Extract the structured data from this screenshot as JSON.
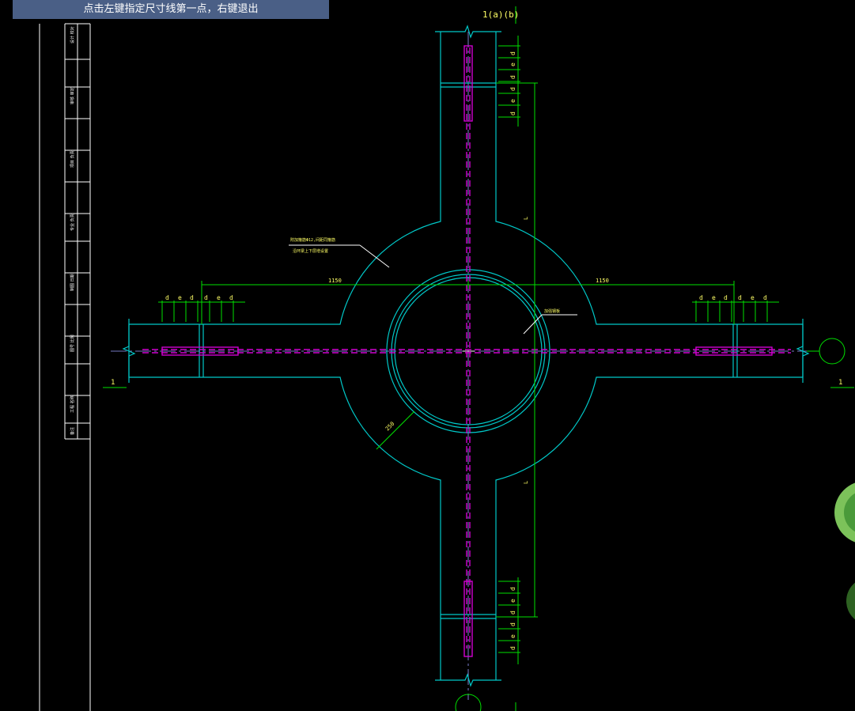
{
  "status_prompt": "点击左键指定尺寸线第一点，右键退出",
  "drawing": {
    "grid_label_top": "1(a)(b)",
    "section_mark_left": "1",
    "section_mark_right": "1",
    "dim_left": "1150",
    "dim_right": "1150",
    "dim_length_upper": "L",
    "dim_length_lower": "L",
    "dim_hole": "250",
    "bar_d": "d",
    "bar_e": "e",
    "note_stirrup_line1": "附加箍筋Φ12,间距同箍筋",
    "note_stirrup_line2": "沿环梁上下层增设置",
    "note_center": "加强钢板"
  },
  "title_block": {
    "cells": [
      {
        "label": "设计 校对"
      },
      {
        "label": "审核 审定"
      },
      {
        "label": "项目 负责"
      },
      {
        "label": "专业 负责"
      },
      {
        "label": "制图 日期"
      },
      {
        "label": "图号 比例"
      },
      {
        "label": "工程 名称"
      },
      {
        "label": "备注"
      }
    ]
  },
  "colors": {
    "background": "#000000",
    "beam": "#00c8c8",
    "dimension": "#00e000",
    "rebar": "#d000d0",
    "text": "#ffff66",
    "prompt_bg": "#4a5f86"
  }
}
